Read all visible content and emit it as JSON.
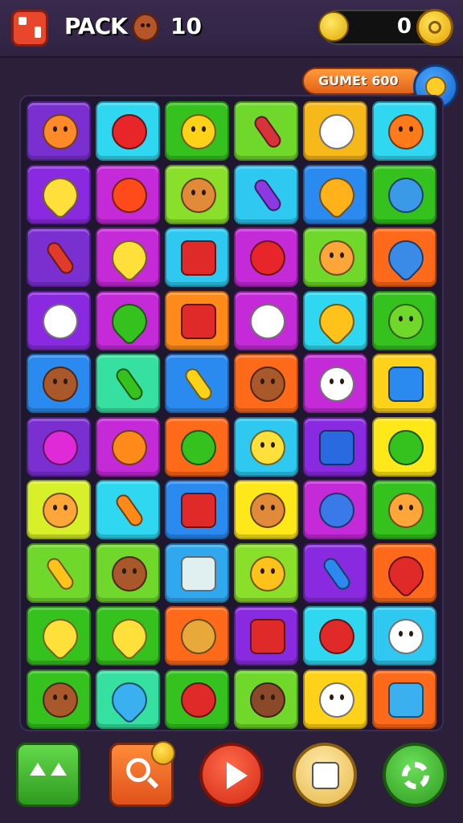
{
  "header": {
    "pack_label": "PACK",
    "pack_number": "10",
    "coin_count": "0"
  },
  "game_button": {
    "label": "GUMEt 600"
  },
  "board": {
    "rows": 10,
    "cols": 6,
    "tiles": [
      [
        {
          "bg": "#7a2fd0",
          "icon": "orange-face-icon",
          "c": "#ff8a2a"
        },
        {
          "bg": "#2fd8f0",
          "icon": "apple-icon",
          "c": "#e8262a"
        },
        {
          "bg": "#36c21e",
          "icon": "smiley-face-icon",
          "c": "#ffd21a"
        },
        {
          "bg": "#6fd82a",
          "icon": "bottle-icon",
          "c": "#d8323a"
        },
        {
          "bg": "#f7b81a",
          "icon": "ghost-icon",
          "c": "#ffffff"
        },
        {
          "bg": "#2fd8f0",
          "icon": "sun-face-icon",
          "c": "#ff7a1a"
        }
      ],
      [
        {
          "bg": "#8a2ae0",
          "icon": "lemon-icon",
          "c": "#ffe03a"
        },
        {
          "bg": "#c42ad8",
          "icon": "sun-icon",
          "c": "#ff4a1a"
        },
        {
          "bg": "#8adf2a",
          "icon": "hat-face-icon",
          "c": "#e08a3a"
        },
        {
          "bg": "#2fc8f0",
          "icon": "paint-tube-icon",
          "c": "#8a3ae0"
        },
        {
          "bg": "#2a8af0",
          "icon": "banana-icon",
          "c": "#ffb21a"
        },
        {
          "bg": "#36c21e",
          "icon": "lollipop-icon",
          "c": "#3a9ae8"
        }
      ],
      [
        {
          "bg": "#7a2fd0",
          "icon": "battery-icon",
          "c": "#e03a2a"
        },
        {
          "bg": "#c42ad8",
          "icon": "lemon-icon",
          "c": "#ffe03a"
        },
        {
          "bg": "#2fc8f0",
          "icon": "bucket-icon",
          "c": "#e02a2a"
        },
        {
          "bg": "#c42ad8",
          "icon": "apple-icon",
          "c": "#e8262a"
        },
        {
          "bg": "#6fd82a",
          "icon": "smiley-face-icon",
          "c": "#ffa63a"
        },
        {
          "bg": "#ff6a1a",
          "icon": "balloon-icon",
          "c": "#3a8ae8"
        }
      ],
      [
        {
          "bg": "#8a2ae0",
          "icon": "note-icon",
          "c": "#ffffff"
        },
        {
          "bg": "#c42ad8",
          "icon": "leaf-icon",
          "c": "#36c21e"
        },
        {
          "bg": "#ff8a1a",
          "icon": "card-icon",
          "c": "#e02a2a"
        },
        {
          "bg": "#c42ad8",
          "icon": "skull-icon",
          "c": "#ffffff"
        },
        {
          "bg": "#2fd8f0",
          "icon": "banana-icon",
          "c": "#ffc21a"
        },
        {
          "bg": "#36c21e",
          "icon": "cup-face-icon",
          "c": "#6fd82a"
        }
      ],
      [
        {
          "bg": "#2a8af0",
          "icon": "bear-face-icon",
          "c": "#a8582a"
        },
        {
          "bg": "#36e0a0",
          "icon": "cucumber-icon",
          "c": "#36c21e"
        },
        {
          "bg": "#2a8af0",
          "icon": "crayon-icon",
          "c": "#ffd21a"
        },
        {
          "bg": "#ff6a1a",
          "icon": "bear-face-icon",
          "c": "#a8582a"
        },
        {
          "bg": "#c42ad8",
          "icon": "cat-face-icon",
          "c": "#ffffff"
        },
        {
          "bg": "#ffd21a",
          "icon": "shield-icon",
          "c": "#2a8af0"
        }
      ],
      [
        {
          "bg": "#7a2fd0",
          "icon": "heart-icon",
          "c": "#e02ad8"
        },
        {
          "bg": "#c42ad8",
          "icon": "star-icon",
          "c": "#ff8a1a"
        },
        {
          "bg": "#ff6a1a",
          "icon": "turtle-icon",
          "c": "#36c21e"
        },
        {
          "bg": "#2fc8f0",
          "icon": "smiley-face-icon",
          "c": "#ffe03a"
        },
        {
          "bg": "#8a2ae0",
          "icon": "badge-icon",
          "c": "#2a6ae0"
        },
        {
          "bg": "#ffe81a",
          "icon": "lime-icon",
          "c": "#36c21e"
        }
      ],
      [
        {
          "bg": "#d8f02a",
          "icon": "smiley-face-icon",
          "c": "#ffa63a"
        },
        {
          "bg": "#2fd8f0",
          "icon": "pencil-icon",
          "c": "#ff8a1a"
        },
        {
          "bg": "#2a8af0",
          "icon": "sign-icon",
          "c": "#e02a2a"
        },
        {
          "bg": "#ffe81a",
          "icon": "bear-face-icon",
          "c": "#e08a3a"
        },
        {
          "bg": "#c42ad8",
          "icon": "planet-icon",
          "c": "#3a7ae8"
        },
        {
          "bg": "#36c21e",
          "icon": "orange-face-icon",
          "c": "#ffa63a"
        }
      ],
      [
        {
          "bg": "#6fd82a",
          "icon": "crayon-icon",
          "c": "#ffc21a"
        },
        {
          "bg": "#6fd82a",
          "icon": "bear-face-icon",
          "c": "#a8582a"
        },
        {
          "bg": "#2fa8f0",
          "icon": "glass-icon",
          "c": "#e0f0f0"
        },
        {
          "bg": "#8adf2a",
          "icon": "orange-face-icon",
          "c": "#ffc21a"
        },
        {
          "bg": "#8a2ae0",
          "icon": "bottle-icon",
          "c": "#2a8af0"
        },
        {
          "bg": "#ff6a1a",
          "icon": "balloon-icon",
          "c": "#e02a2a"
        }
      ],
      [
        {
          "bg": "#36c21e",
          "icon": "lemon-icon",
          "c": "#ffe03a"
        },
        {
          "bg": "#36c21e",
          "icon": "lemon-icon",
          "c": "#ffe03a"
        },
        {
          "bg": "#ff6a1a",
          "icon": "bread-icon",
          "c": "#e8a83a"
        },
        {
          "bg": "#8a2ae0",
          "icon": "box-icon",
          "c": "#e02a2a"
        },
        {
          "bg": "#2fd8f0",
          "icon": "apple-icon",
          "c": "#e02a2a"
        },
        {
          "bg": "#2fc8f0",
          "icon": "ghost-face-icon",
          "c": "#ffffff"
        }
      ],
      [
        {
          "bg": "#36c21e",
          "icon": "bear-face-icon",
          "c": "#a8582a"
        },
        {
          "bg": "#36e0a0",
          "icon": "leaf-icon",
          "c": "#3ab0f0"
        },
        {
          "bg": "#36c21e",
          "icon": "music-note-icon",
          "c": "#e02a2a"
        },
        {
          "bg": "#6fd82a",
          "icon": "bear-face-icon",
          "c": "#8a4a2a"
        },
        {
          "bg": "#ffd21a",
          "icon": "dog-face-icon",
          "c": "#ffffff"
        },
        {
          "bg": "#ff6a1a",
          "icon": "basket-icon",
          "c": "#3ab0f0"
        }
      ]
    ]
  },
  "bottom_bar": {
    "buttons": [
      {
        "name": "boost-button",
        "icon": "double-arrow-up-icon"
      },
      {
        "name": "search-button",
        "icon": "magnifier-icon"
      },
      {
        "name": "play-button",
        "icon": "play-icon"
      },
      {
        "name": "dice-button",
        "icon": "dice-icon"
      },
      {
        "name": "settings-button",
        "icon": "gear-icon"
      }
    ]
  }
}
